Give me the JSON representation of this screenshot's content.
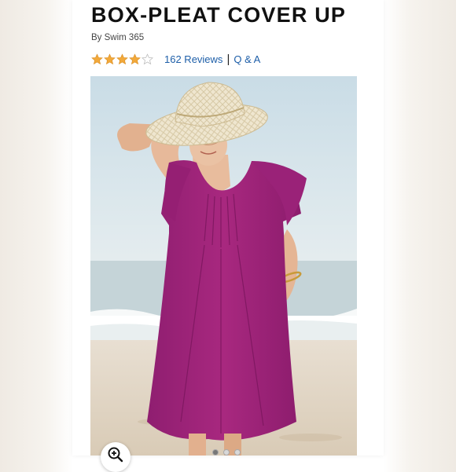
{
  "product": {
    "title": "BOX-PLEAT COVER UP",
    "brand_line": "By Swim 365",
    "rating": 4.0,
    "rating_max": 5,
    "reviews_label": "162 Reviews",
    "separator": "|",
    "qa_label": "Q & A"
  },
  "image": {
    "icon": "zoom-in-icon",
    "carousel_count": 3,
    "carousel_active": 0
  },
  "colors": {
    "star": "#f2a93b",
    "link": "#1d5ea8",
    "dress": "#a0247e"
  }
}
